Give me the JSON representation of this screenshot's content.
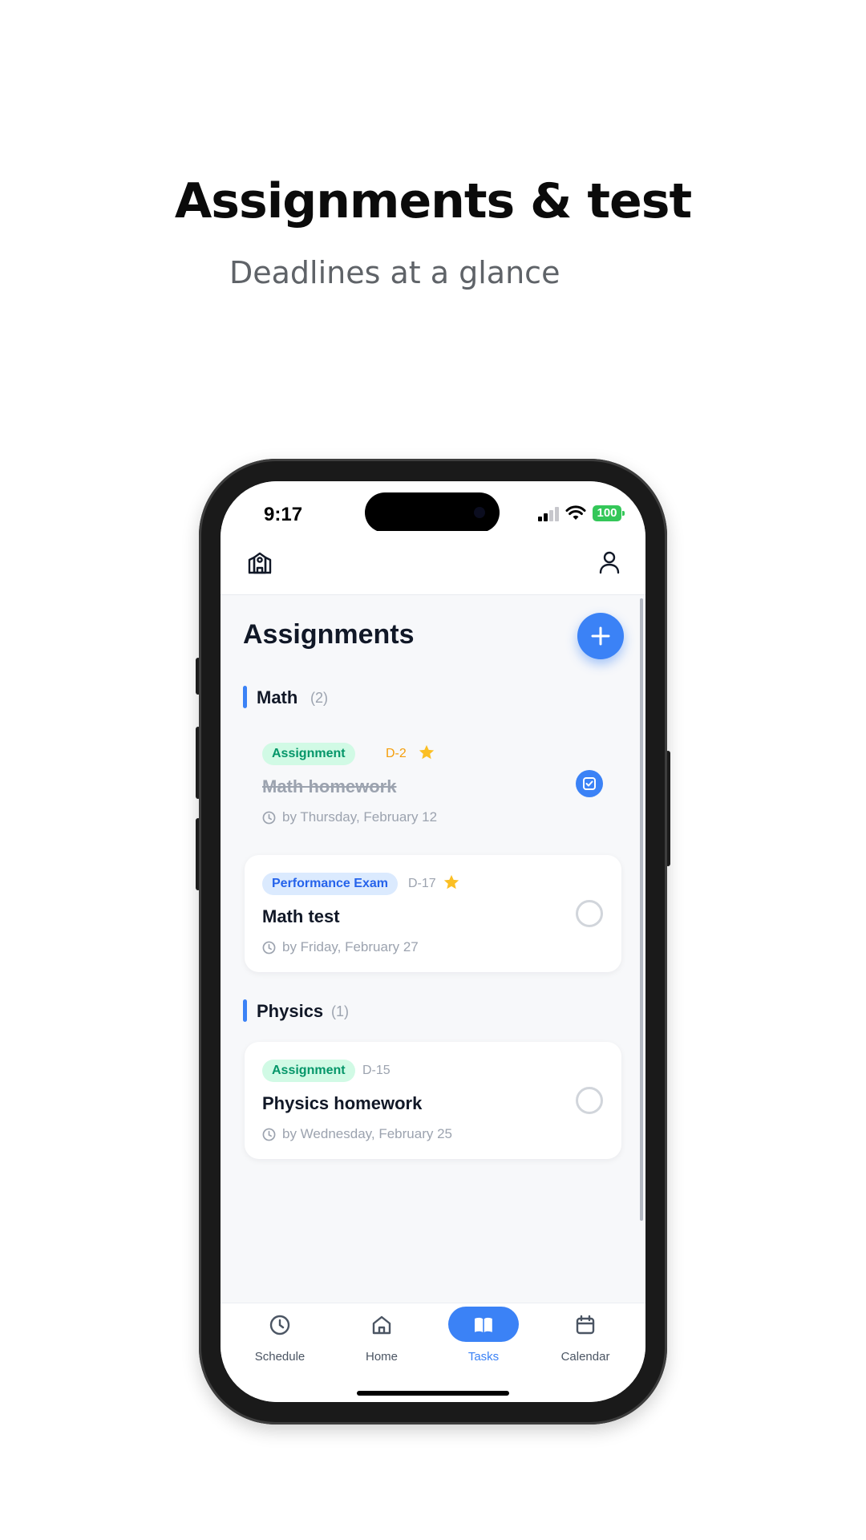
{
  "promo": {
    "title": "Assignments & test",
    "subtitle": "Deadlines at a glance"
  },
  "status_bar": {
    "time": "9:17",
    "battery": "100",
    "battery_color": "#34c759"
  },
  "header": {
    "left_icon": "school-icon",
    "right_icon": "profile-icon"
  },
  "page": {
    "title": "Assignments",
    "add_icon": "plus-icon",
    "accent_color": "#3b82f6"
  },
  "sections": [
    {
      "name": "Math",
      "count": "(2)",
      "tasks": [
        {
          "badge": "Assignment",
          "badge_color": "green",
          "dday": "D-2",
          "dday_color": "#f59e0b",
          "starred": true,
          "title": "Math homework",
          "due": "by Thursday, February 12",
          "completed": true
        },
        {
          "badge": "Performance Exam",
          "badge_color": "blue",
          "dday": "D-17",
          "dday_color": "#9ca3af",
          "starred": true,
          "title": "Math test",
          "due": "by Friday, February 27",
          "completed": false
        }
      ]
    },
    {
      "name": "Physics",
      "count": "(1)",
      "tasks": [
        {
          "badge": "Assignment",
          "badge_color": "green",
          "dday": "D-15",
          "dday_color": "#9ca3af",
          "starred": false,
          "title": "Physics homework",
          "due": "by Wednesday, February 25",
          "completed": false
        }
      ]
    }
  ],
  "tabbar": {
    "items": [
      {
        "label": "Schedule",
        "icon": "clock-icon",
        "active": false
      },
      {
        "label": "Home",
        "icon": "home-icon",
        "active": false
      },
      {
        "label": "Tasks",
        "icon": "book-icon",
        "active": true
      },
      {
        "label": "Calendar",
        "icon": "calendar-icon",
        "active": false
      }
    ]
  }
}
